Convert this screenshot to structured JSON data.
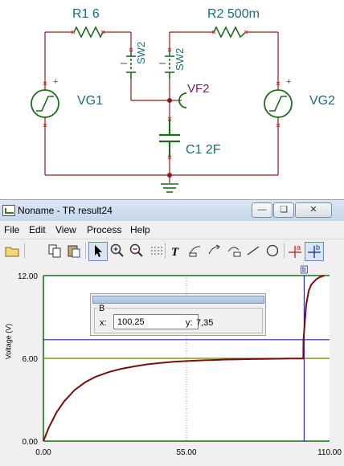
{
  "schematic": {
    "r1_label": "R1 6",
    "r2_label": "R2 500m",
    "sw_left_label": "SW2",
    "sw_right_label": "SW2",
    "vf2_label": "VF2",
    "vg1_label": "VG1",
    "vg2_label": "VG2",
    "c1_label": "C1 2F",
    "plus_sign": "+"
  },
  "window": {
    "title": "Noname - TR result24",
    "minimize": "—",
    "restore": "❏",
    "close": "✕"
  },
  "menu": {
    "file": "File",
    "edit": "Edit",
    "view": "View",
    "process": "Process",
    "help": "Help"
  },
  "toolbar": {
    "icons": [
      "folder-icon",
      "copy-icon",
      "paste-icon",
      "arrow-icon",
      "zoom-in-icon",
      "zoom-out-icon",
      "grid-icon",
      "text-icon",
      "tool-a-icon",
      "tool-b-icon",
      "tool-c-icon",
      "line-icon",
      "circle-icon",
      "cursor-a-icon",
      "cursor-b-icon"
    ],
    "cursor_a_letter": "a",
    "cursor_b_letter": "b"
  },
  "plot": {
    "ylabel": "Voltage (V)",
    "cursor_marker": "b"
  },
  "cursor_box": {
    "group_label": "B",
    "x_label": "x:",
    "x_value": "100,25",
    "y_label": "y:",
    "y_value": "7,35"
  },
  "chart_data": {
    "type": "line",
    "ylabel": "Voltage (V)",
    "xlim": [
      0,
      110
    ],
    "ylim": [
      0,
      12
    ],
    "x_ticks": [
      "0.00",
      "55.00",
      "110.00"
    ],
    "y_ticks": [
      "0.00",
      "6.00",
      "12.00"
    ],
    "grid": "x at 55 (dotted)",
    "series": [
      {
        "color": "#7a0d0d",
        "x": [
          0,
          2,
          5,
          8,
          12,
          16,
          20,
          25,
          30,
          35,
          40,
          45,
          50,
          55,
          60,
          65,
          70,
          75,
          80,
          85,
          90,
          95,
          99.9,
          100,
          101,
          102,
          103,
          104,
          105,
          106,
          107,
          108
        ],
        "values": [
          0,
          0.95,
          2.07,
          2.89,
          3.7,
          4.26,
          4.66,
          5.0,
          5.24,
          5.42,
          5.57,
          5.67,
          5.75,
          5.8,
          5.85,
          5.88,
          5.91,
          5.93,
          5.95,
          5.96,
          5.97,
          5.98,
          5.99,
          7.35,
          9.85,
          10.9,
          11.35,
          11.55,
          11.75,
          11.86,
          11.94,
          12.0
        ]
      }
    ],
    "h_lines": [
      {
        "y": 7.35,
        "color": "#2a2aa8"
      },
      {
        "y": 6.0,
        "color": "#7a7a00"
      }
    ],
    "v_lines": [
      {
        "x": 100.25,
        "color": "#2a2aa8"
      }
    ]
  }
}
